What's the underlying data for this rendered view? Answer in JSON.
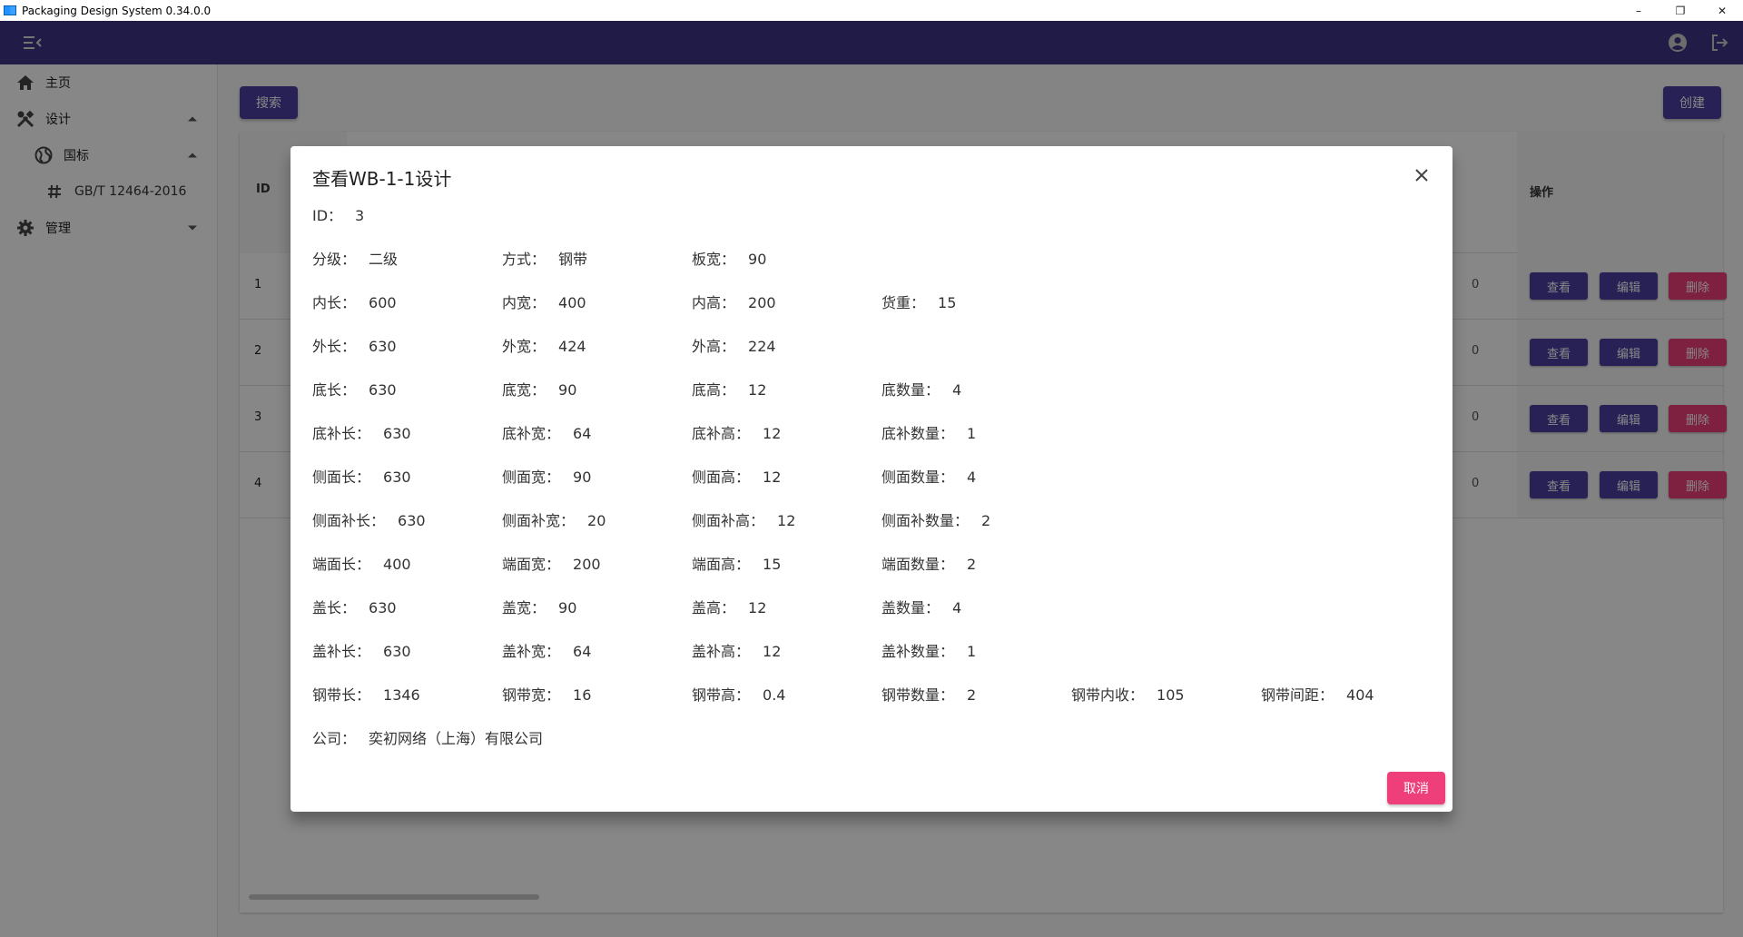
{
  "window": {
    "title": "Packaging Design System 0.34.0.0",
    "controls": [
      "–",
      "❐",
      "✕"
    ]
  },
  "appbar": {
    "menu_icon": "menu-collapse-icon",
    "account_icon": "account-circle-icon",
    "logout_icon": "logout-icon",
    "color": "#3e3387"
  },
  "sidebar": {
    "items": [
      {
        "label": "主页",
        "icon": "home-icon"
      },
      {
        "label": "设计",
        "icon": "tools-icon"
      },
      {
        "label": "国标",
        "icon": "globe-icon"
      },
      {
        "label": "GB/T 12464-2016",
        "icon": "hash-icon"
      },
      {
        "label": "管理",
        "icon": "gear-icon"
      }
    ]
  },
  "main": {
    "search_label": "搜索",
    "create_label": "创建",
    "table": {
      "headers": {
        "id": "ID",
        "actions": "操作"
      },
      "rows": [
        {
          "id": "1",
          "trail": "0"
        },
        {
          "id": "2",
          "trail": "0"
        },
        {
          "id": "3",
          "trail": "0"
        },
        {
          "id": "4",
          "trail": "0"
        }
      ],
      "action_labels": {
        "view": "查看",
        "edit": "编辑",
        "delete": "删除"
      }
    }
  },
  "dialog": {
    "title": "查看WB-1-1设计",
    "rows": [
      [
        {
          "k": "ID：",
          "v": "3"
        }
      ],
      [
        {
          "k": "分级：",
          "v": "二级"
        },
        {
          "k": "方式：",
          "v": "钢带"
        },
        {
          "k": "板宽：",
          "v": "90"
        }
      ],
      [
        {
          "k": "内长：",
          "v": "600"
        },
        {
          "k": "内宽：",
          "v": "400"
        },
        {
          "k": "内高：",
          "v": "200"
        },
        {
          "k": "货重：",
          "v": "15"
        }
      ],
      [
        {
          "k": "外长：",
          "v": "630"
        },
        {
          "k": "外宽：",
          "v": "424"
        },
        {
          "k": "外高：",
          "v": "224"
        }
      ],
      [
        {
          "k": "底长：",
          "v": "630"
        },
        {
          "k": "底宽：",
          "v": "90"
        },
        {
          "k": "底高：",
          "v": "12"
        },
        {
          "k": "底数量：",
          "v": "4"
        }
      ],
      [
        {
          "k": "底补长：",
          "v": "630"
        },
        {
          "k": "底补宽：",
          "v": "64"
        },
        {
          "k": "底补高：",
          "v": "12"
        },
        {
          "k": "底补数量：",
          "v": "1"
        }
      ],
      [
        {
          "k": "侧面长：",
          "v": "630"
        },
        {
          "k": "侧面宽：",
          "v": "90"
        },
        {
          "k": "侧面高：",
          "v": "12"
        },
        {
          "k": "侧面数量：",
          "v": "4"
        }
      ],
      [
        {
          "k": "侧面补长：",
          "v": "630"
        },
        {
          "k": "侧面补宽：",
          "v": "20"
        },
        {
          "k": "侧面补高：",
          "v": "12"
        },
        {
          "k": "侧面补数量：",
          "v": "2"
        }
      ],
      [
        {
          "k": "端面长：",
          "v": "400"
        },
        {
          "k": "端面宽：",
          "v": "200"
        },
        {
          "k": "端面高：",
          "v": "15"
        },
        {
          "k": "端面数量：",
          "v": "2"
        }
      ],
      [
        {
          "k": "盖长：",
          "v": "630"
        },
        {
          "k": "盖宽：",
          "v": "90"
        },
        {
          "k": "盖高：",
          "v": "12"
        },
        {
          "k": "盖数量：",
          "v": "4"
        }
      ],
      [
        {
          "k": "盖补长：",
          "v": "630"
        },
        {
          "k": "盖补宽：",
          "v": "64"
        },
        {
          "k": "盖补高：",
          "v": "12"
        },
        {
          "k": "盖补数量：",
          "v": "1"
        }
      ],
      [
        {
          "k": "钢带长：",
          "v": "1346"
        },
        {
          "k": "钢带宽：",
          "v": "16"
        },
        {
          "k": "钢带高：",
          "v": "0.4"
        },
        {
          "k": "钢带数量：",
          "v": "2"
        },
        {
          "k": "钢带内收：",
          "v": "105"
        },
        {
          "k": "钢带间距：",
          "v": "404"
        }
      ],
      [
        {
          "k": "公司：",
          "v": "奕初网络（上海）有限公司"
        }
      ]
    ],
    "cancel_label": "取消",
    "close_icon": "close-icon"
  }
}
